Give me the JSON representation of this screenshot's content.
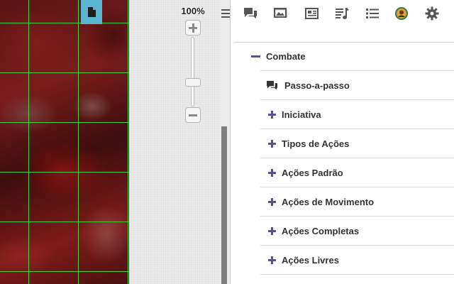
{
  "map": {
    "tool_icon": "page-icon"
  },
  "zoom": {
    "level_text": "100%",
    "slider_level": 0.6,
    "in_icon": "plus-icon",
    "out_icon": "minus-icon"
  },
  "toolbar": {
    "menu_icon": "hamburger-icon",
    "tabs": [
      {
        "name": "chat-tab",
        "icon": "chat-bubbles-icon"
      },
      {
        "name": "art-library-tab",
        "icon": "images-icon"
      },
      {
        "name": "journal-tab",
        "icon": "newspaper-icon"
      },
      {
        "name": "jukebox-tab",
        "icon": "music-list-icon"
      },
      {
        "name": "compendium-tab",
        "icon": "bulleted-list-icon"
      },
      {
        "name": "my-settings-tab",
        "icon": "avatar-icon"
      },
      {
        "name": "game-settings-tab",
        "icon": "gear-icon"
      }
    ]
  },
  "compendium": {
    "section": {
      "label": "Combate",
      "state": "expanded"
    },
    "items": [
      {
        "label": "Passo-a-passo",
        "icon": "chat-bubbles-icon"
      },
      {
        "label": "Iniciativa",
        "icon": "plus-icon"
      },
      {
        "label": "Tipos de Ações",
        "icon": "plus-icon"
      },
      {
        "label": "Ações Padrão",
        "icon": "plus-icon"
      },
      {
        "label": "Ações de Movimento",
        "icon": "plus-icon"
      },
      {
        "label": "Ações Completas",
        "icon": "plus-icon"
      },
      {
        "label": "Ações Livres",
        "icon": "plus-icon"
      }
    ]
  },
  "colors": {
    "accent": "#5e5089",
    "grid": "#4cd137",
    "tool_button": "#5ab6d0",
    "map_base": "#6b1717"
  }
}
